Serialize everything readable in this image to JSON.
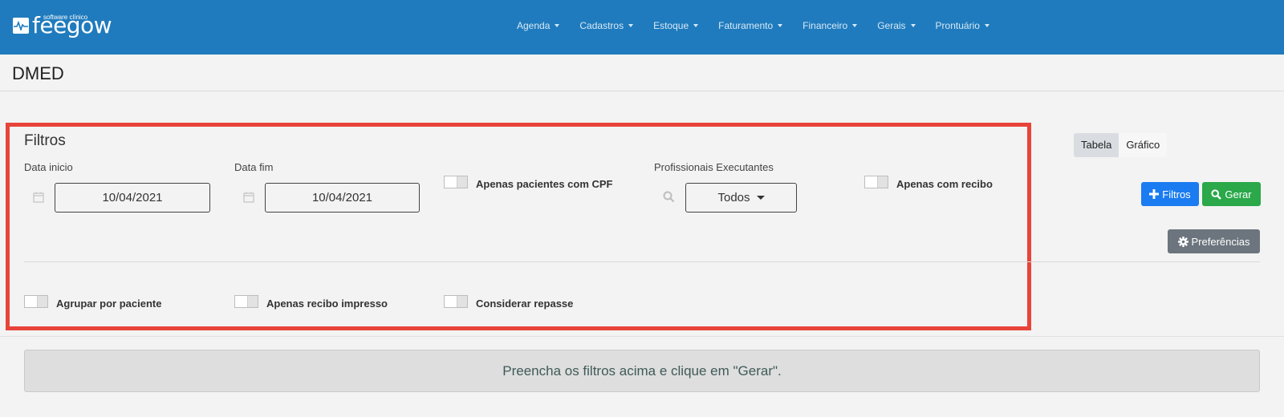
{
  "brand": {
    "name": "feegow",
    "tagline": "software clínico"
  },
  "nav": {
    "items": [
      {
        "label": "Agenda"
      },
      {
        "label": "Cadastros"
      },
      {
        "label": "Estoque"
      },
      {
        "label": "Faturamento"
      },
      {
        "label": "Financeiro"
      },
      {
        "label": "Gerais"
      },
      {
        "label": "Prontuário"
      }
    ]
  },
  "page": {
    "title": "DMED"
  },
  "filters": {
    "title": "Filtros",
    "data_inicio": {
      "label": "Data inicio",
      "value": "10/04/2021"
    },
    "data_fim": {
      "label": "Data fim",
      "value": "10/04/2021"
    },
    "apenas_cpf": {
      "label": "Apenas pacientes com CPF",
      "checked": false
    },
    "profissionais": {
      "label": "Profissionais Executantes",
      "value": "Todos"
    },
    "apenas_recibo": {
      "label": "Apenas com recibo",
      "checked": false
    },
    "agrupar_paciente": {
      "label": "Agrupar por paciente",
      "checked": false
    },
    "recibo_impresso": {
      "label": "Apenas recibo impresso",
      "checked": false
    },
    "considerar_repasse": {
      "label": "Considerar repasse",
      "checked": false
    }
  },
  "view_toggle": {
    "table_label": "Tabela",
    "chart_label": "Gráfico",
    "active": "Tabela"
  },
  "actions": {
    "filtros_label": "Filtros",
    "gerar_label": "Gerar",
    "preferencias_label": "Preferências"
  },
  "message": "Preencha os filtros acima e clique em \"Gerar\".",
  "colors": {
    "navbar": "#1f7bbd",
    "highlight_border": "#e8443a",
    "primary": "#1a7cf0",
    "success": "#2aa84a",
    "secondary": "#6c757d"
  },
  "icons": [
    "calendar-icon",
    "search-icon",
    "plus-icon",
    "gear-icon",
    "caret-down-icon"
  ]
}
